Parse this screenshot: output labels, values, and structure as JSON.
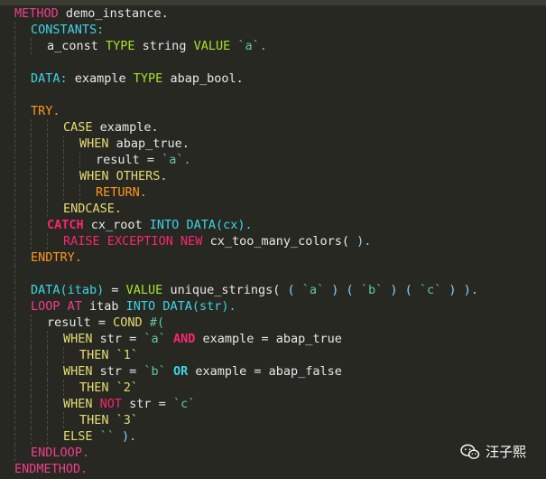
{
  "code_lines": [
    [
      "METHOD",
      " demo_instance."
    ],
    [
      "CONSTANTS:"
    ],
    [
      "a_const",
      " TYPE",
      " string",
      " VALUE",
      " `a`."
    ],
    [
      ""
    ],
    [
      "DATA:",
      " example",
      " TYPE",
      " abap_bool."
    ],
    [
      ""
    ],
    [
      "TRY."
    ],
    [
      "CASE",
      " example."
    ],
    [
      "WHEN",
      " abap_true."
    ],
    [
      "result",
      " =",
      " `a`."
    ],
    [
      "WHEN",
      " OTHERS."
    ],
    [
      "RETURN."
    ],
    [
      "ENDCASE."
    ],
    [
      "CATCH",
      " cx_root",
      " INTO",
      " DATA(cx)."
    ],
    [
      "RAISE",
      " EXCEPTION",
      " NEW",
      " cx_too_many_colors(",
      " )."
    ],
    [
      "ENDTRY."
    ],
    [
      ""
    ],
    [
      "DATA(itab)",
      " =",
      " VALUE",
      " unique_strings(",
      " (",
      " `a`",
      " )",
      " (",
      " `b`",
      " )",
      " (",
      " `c`",
      " )",
      " )."
    ],
    [
      "LOOP",
      " AT",
      " itab",
      " INTO",
      " DATA(str)."
    ],
    [
      "result",
      " =",
      " COND",
      " #("
    ],
    [
      "WHEN",
      " str",
      " =",
      " `a`",
      " AND",
      " example",
      " =",
      " abap_true"
    ],
    [
      "THEN",
      " `1`"
    ],
    [
      "WHEN",
      " str",
      " =",
      " `b`",
      " OR",
      " example",
      " =",
      " abap_false"
    ],
    [
      "THEN",
      " `2`"
    ],
    [
      "WHEN",
      " NOT",
      " str",
      " =",
      " `c`"
    ],
    [
      "THEN",
      " `3`"
    ],
    [
      "ELSE",
      " ``",
      " )."
    ],
    [
      "ENDLOOP."
    ],
    [
      "ENDMETHOD."
    ]
  ],
  "watermark": {
    "text": "汪子熙",
    "icon": "wechat-icon"
  },
  "colors": {
    "background": "#272822",
    "keyword_pink": "#f92672",
    "keyword_cyan": "#3fd4e6",
    "keyword_green": "#a6e22e",
    "keyword_yellow": "#e6db74",
    "keyword_orange": "#fd971f",
    "string": "#5fc8a8"
  }
}
